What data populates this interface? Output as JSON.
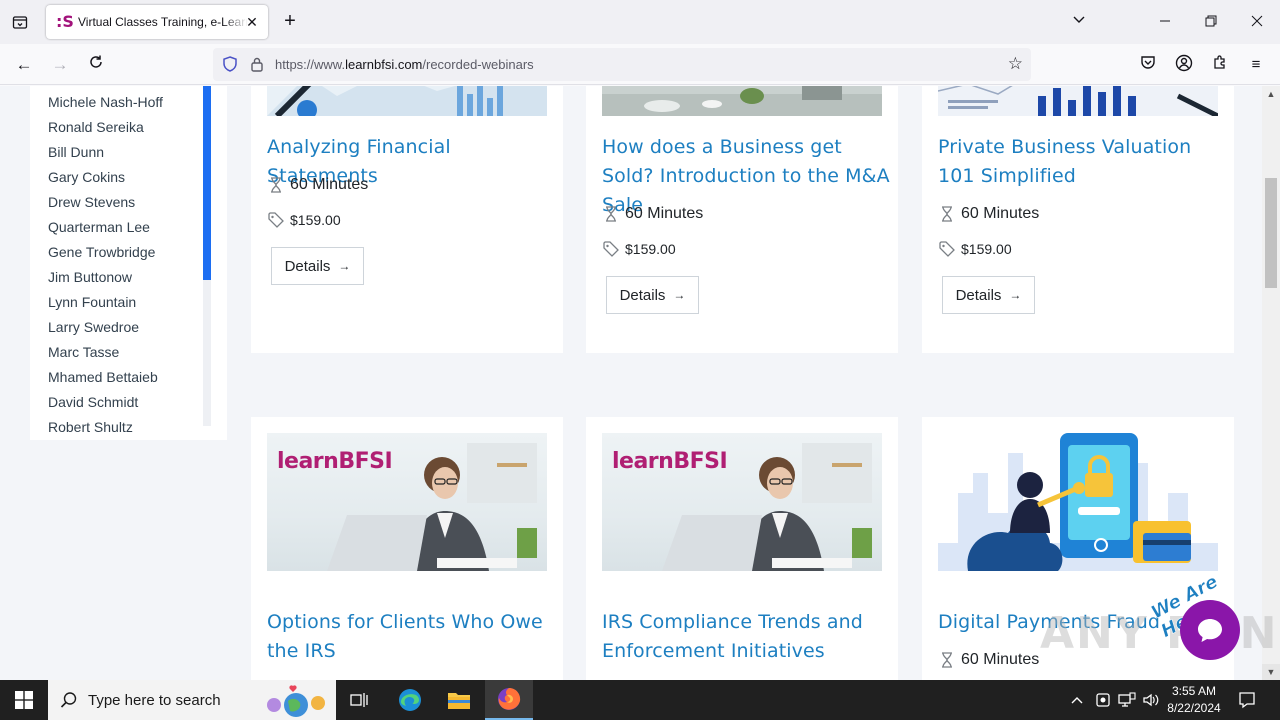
{
  "browser": {
    "tab_title": "Virtual Classes Training, e-Learning",
    "url_prefix": "https://www.",
    "url_domain": "learnbfsi.com",
    "url_path": "/recorded-webinars"
  },
  "sidebar": {
    "speakers": [
      "Michele Nash-Hoff",
      "Ronald Sereika",
      "Bill Dunn",
      "Gary Cokins",
      "Drew Stevens",
      "Quarterman Lee",
      "Gene Trowbridge",
      "Jim Buttonow",
      "Lynn Fountain",
      "Larry Swedroe",
      "Marc Tasse",
      "Mhamed Bettaieb",
      "David Schmidt",
      "Robert Shultz"
    ]
  },
  "courses": [
    {
      "title": "Analyzing Financial Statements",
      "duration": "60 Minutes",
      "price": "$159.00",
      "button": "Details"
    },
    {
      "title": "How does a Business get Sold? Introduction to the M&A Sale",
      "duration": "60 Minutes",
      "price": "$159.00",
      "button": "Details"
    },
    {
      "title": "Private Business Valuation 101 Simplified",
      "duration": "60 Minutes",
      "price": "$159.00",
      "button": "Details"
    },
    {
      "title": "Options for Clients Who Owe the IRS",
      "brand": "learnBFSI"
    },
    {
      "title": "IRS Compliance Trends and Enforcement Initiatives",
      "brand": "learnBFSI"
    },
    {
      "title": "Digital Payments Fraud",
      "duration": "60 Minutes"
    }
  ],
  "overlay": {
    "watermark": "ANY RUN",
    "chat_label": "We Are Here!"
  },
  "taskbar": {
    "search_placeholder": "Type here to search",
    "time": "3:55 AM",
    "date": "8/22/2024"
  },
  "colors": {
    "link": "#1d7fc1",
    "brand": "#b01f73",
    "scroll_accent": "#1c6ef2",
    "chat": "#8a16a9"
  }
}
